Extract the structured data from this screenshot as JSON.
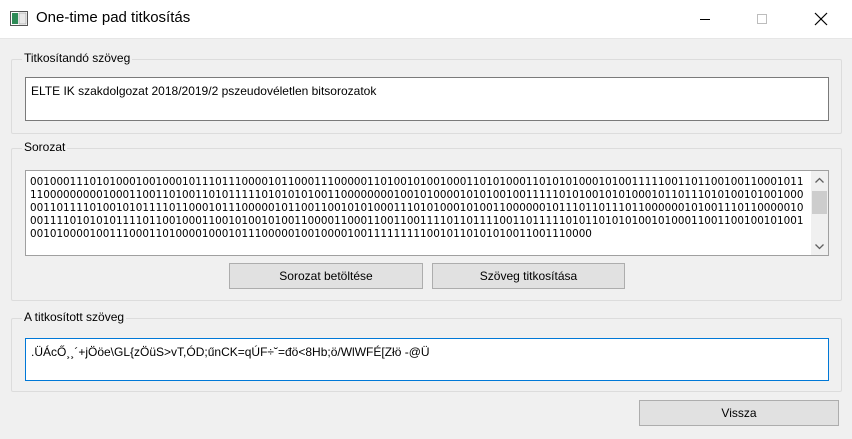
{
  "window": {
    "title": "One-time pad titkosítás"
  },
  "input_group": {
    "title": "Titkosítandó szöveg",
    "value": "ELTE IK szakdolgozat 2018/2019/2 pszeudovéletlen bitsorozatok"
  },
  "sequence_group": {
    "title": "Sorozat",
    "bits": "0010001110101000100100010111011100001011000111000001101001010010001101010001101010100010100111110011011001001100010111100000000010001100110100110101111101010101001100000000100101000010101001001111101010010101000101101110101001010010000011011110100101011110110001011100000101100110010101000111010100010100110000001011101101110110000001010011101100000100011110101010111101100100011001010010100110000110001100110011110110111100110111110101101010100101000110011001001010010010100001001110001101000010001011100000100100001001111111110010110101010011001110000"
  },
  "buttons": {
    "load_label": "Sorozat betöltése",
    "encrypt_label": "Szöveg titkosítása",
    "back_label": "Vissza"
  },
  "output_group": {
    "title": "A titkosított szöveg",
    "value": ".ÜÁcŐ¸¸´+jÖöe\\GL{zÖüS>vT,ÓD;űnCK=qÚF÷˘=đö<8Hb;ö/WlWFÉ[Złö -@Ü"
  }
}
